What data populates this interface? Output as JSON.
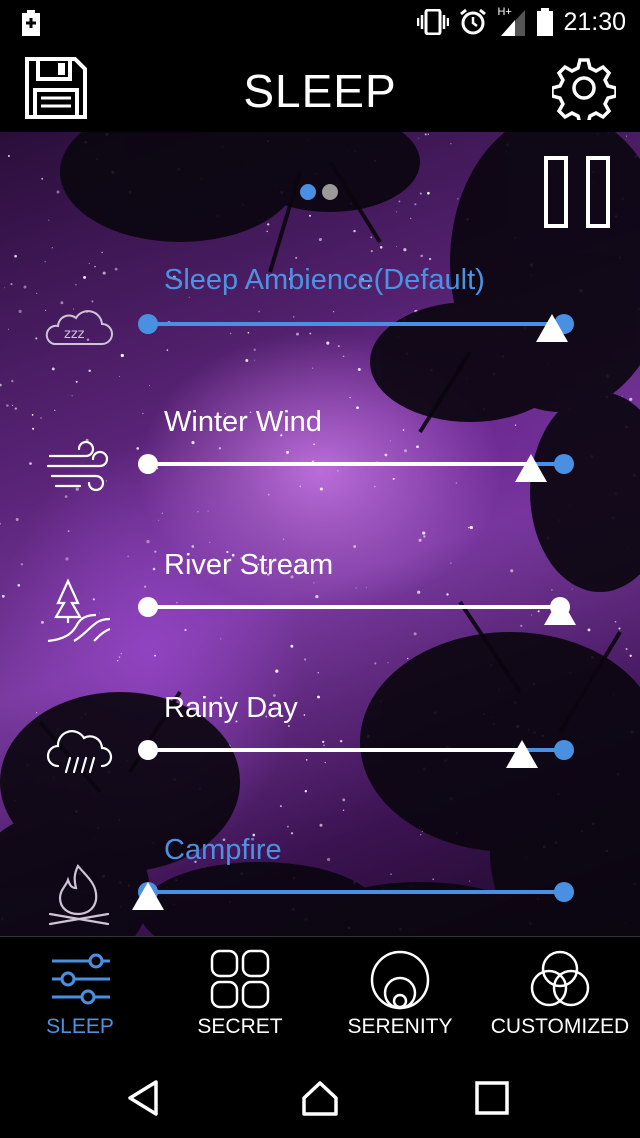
{
  "status_bar": {
    "time": "21:30",
    "network": "H+",
    "icons": [
      "battery-plus-icon",
      "vibrate-icon",
      "alarm-icon",
      "signal-icon",
      "battery-icon"
    ]
  },
  "header": {
    "title": "SLEEP",
    "left_icon": "save-icon",
    "right_icon": "gear-icon"
  },
  "page_indicator": {
    "pages": 2,
    "current": 1,
    "active_color": "#4a90e2",
    "inactive_color": "#9a9a9a"
  },
  "tracks": [
    {
      "label": "Sleep Ambience(Default)",
      "icon": "sleep-cloud-icon",
      "active": true,
      "range_end": 1.0,
      "volume": 0.97
    },
    {
      "label": "Winter Wind",
      "icon": "wind-icon",
      "active": false,
      "range_end": 1.0,
      "volume": 0.92
    },
    {
      "label": "River Stream",
      "icon": "river-tree-icon",
      "active": false,
      "range_end": 0.99,
      "volume": 0.99
    },
    {
      "label": "Rainy Day",
      "icon": "rain-cloud-icon",
      "active": false,
      "range_end": 1.0,
      "volume": 0.9
    },
    {
      "label": "Campfire",
      "icon": "campfire-icon",
      "active": true,
      "range_end": 1.0,
      "volume": 0.0
    }
  ],
  "bottom_nav": [
    {
      "label": "SLEEP",
      "icon": "sliders-icon",
      "active": true
    },
    {
      "label": "SECRET",
      "icon": "grid-icon",
      "active": false
    },
    {
      "label": "SERENITY",
      "icon": "circles-icon",
      "active": false
    },
    {
      "label": "CUSTOMIZED",
      "icon": "venn-icon",
      "active": false
    }
  ],
  "colors": {
    "accent": "#4a90e2",
    "label_active": "#4d92e0",
    "background": "#000000"
  }
}
